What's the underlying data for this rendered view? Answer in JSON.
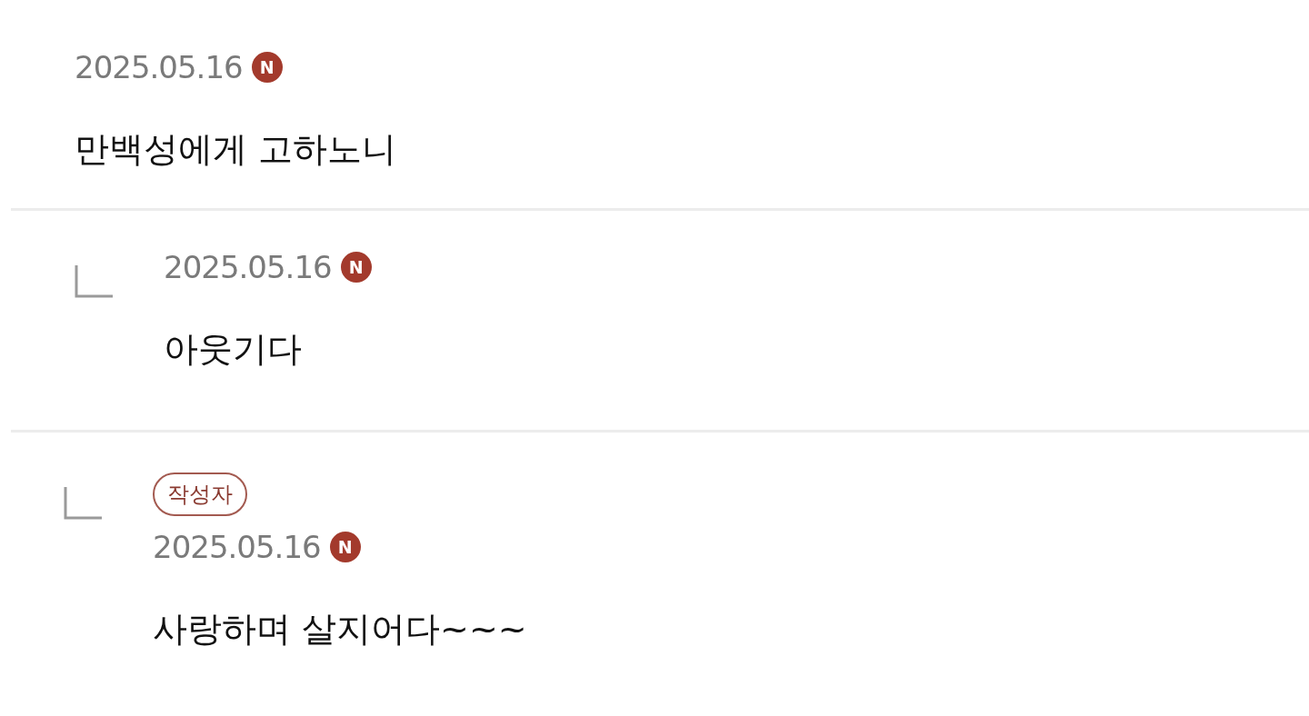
{
  "comments": [
    {
      "kind": "comment",
      "date": "2025.05.16",
      "new_badge": "N",
      "text": "만백성에게 고하노니"
    },
    {
      "kind": "reply",
      "date": "2025.05.16",
      "new_badge": "N",
      "text": "아웃기다"
    },
    {
      "kind": "reply",
      "author_badge": "작성자",
      "date": "2025.05.16",
      "new_badge": "N",
      "text": "사랑하며 살지어다~~~"
    }
  ]
}
